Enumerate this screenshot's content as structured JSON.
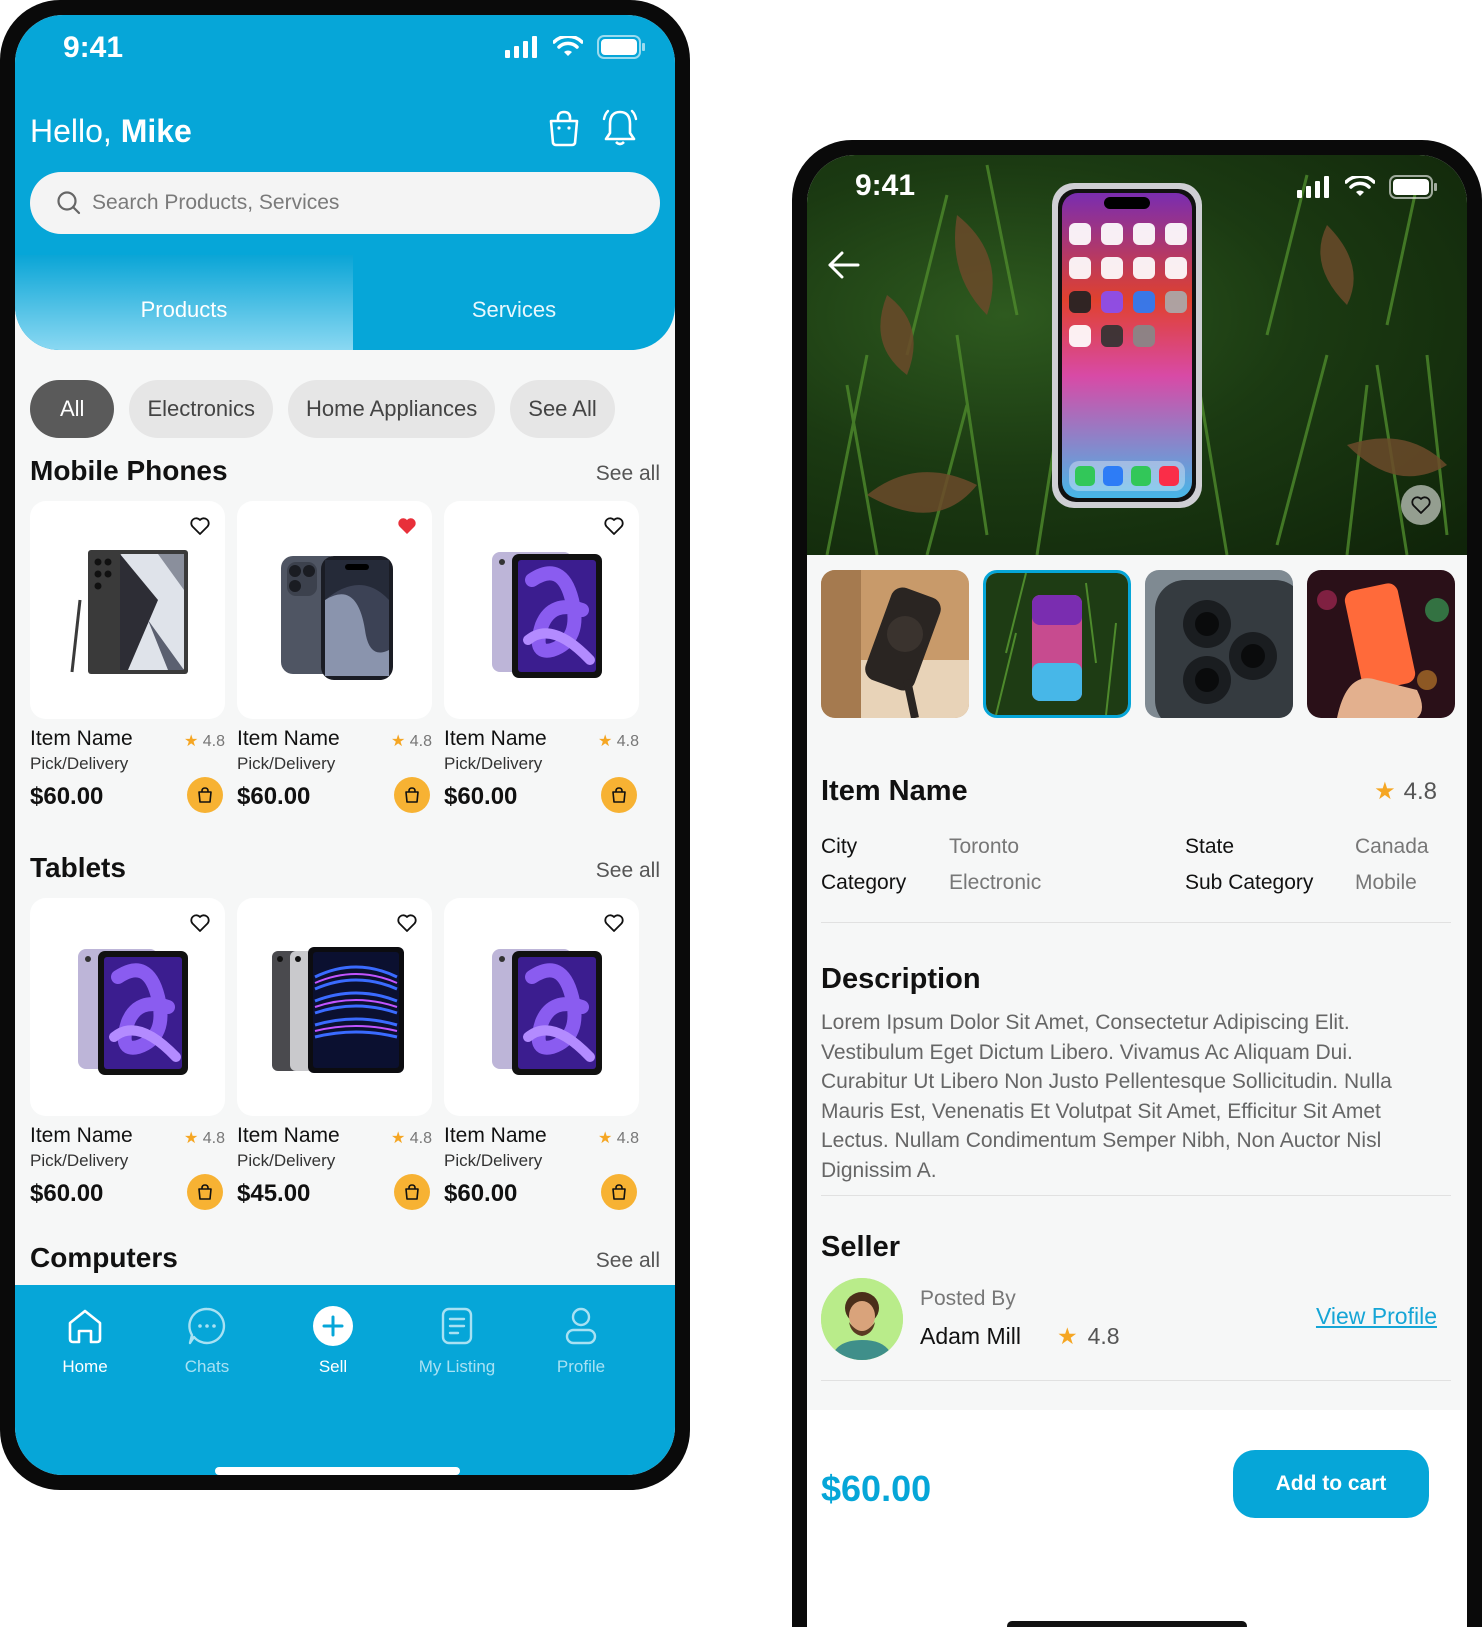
{
  "left_screen": {
    "status_time": "9:41",
    "greeting_prefix": "Hello, ",
    "greeting_name": "Mike",
    "search_placeholder": "Search Products, Services",
    "tabs": [
      "Products",
      "Services"
    ],
    "chips": [
      "All",
      "Electronics",
      "Home Appliances",
      "See All"
    ],
    "sections": [
      {
        "title": "Mobile Phones",
        "see_all": "See all",
        "items": [
          {
            "name": "Item Name",
            "rating": "4.8",
            "delivery": "Pick/Delivery",
            "price": "$60.00",
            "favorite": false,
            "image": "android-phone"
          },
          {
            "name": "Item Name",
            "rating": "4.8",
            "delivery": "Pick/Delivery",
            "price": "$60.00",
            "favorite": true,
            "image": "iphone"
          },
          {
            "name": "Item Name",
            "rating": "4.8",
            "delivery": "Pick/Delivery",
            "price": "$60.00",
            "favorite": false,
            "image": "ipad"
          }
        ]
      },
      {
        "title": "Tablets",
        "see_all": "See all",
        "items": [
          {
            "name": "Item Name",
            "rating": "4.8",
            "delivery": "Pick/Delivery",
            "price": "$60.00",
            "favorite": false,
            "image": "ipad"
          },
          {
            "name": "Item Name",
            "rating": "4.8",
            "delivery": "Pick/Delivery",
            "price": "$45.00",
            "favorite": false,
            "image": "ipad-pro"
          },
          {
            "name": "Item Name",
            "rating": "4.8",
            "delivery": "Pick/Delivery",
            "price": "$60.00",
            "favorite": false,
            "image": "ipad"
          }
        ]
      },
      {
        "title": "Computers",
        "see_all": "See all",
        "items": []
      }
    ],
    "bottom_nav": [
      {
        "label": "Home",
        "icon": "home-icon",
        "active": true
      },
      {
        "label": "Chats",
        "icon": "chat-icon",
        "active": false
      },
      {
        "label": "Sell",
        "icon": "plus-icon",
        "active": true
      },
      {
        "label": "My Listing",
        "icon": "listing-icon",
        "active": false
      },
      {
        "label": "Profile",
        "icon": "profile-icon",
        "active": false
      }
    ]
  },
  "right_screen": {
    "status_time": "9:41",
    "item_name": "Item Name",
    "rating": "4.8",
    "specs": {
      "city_label": "City",
      "city_value": "Toronto",
      "state_label": "State",
      "state_value": "Canada",
      "category_label": "Category",
      "category_value": "Electronic",
      "subcategory_label": "Sub Category",
      "subcategory_value": "Mobile"
    },
    "description_title": "Description",
    "description_text": "Lorem Ipsum Dolor Sit Amet, Consectetur Adipiscing Elit. Vestibulum Eget Dictum Libero. Vivamus Ac Aliquam Dui. Curabitur Ut Libero Non Justo Pellentesque Sollicitudin. Nulla Mauris Est, Venenatis Et Volutpat Sit Amet, Efficitur Sit Amet Lectus. Nullam Condimentum Semper Nibh, Non Auctor Nisl Dignissim A.",
    "seller_title": "Seller",
    "posted_by_label": "Posted By",
    "seller_name": "Adam Mill",
    "seller_rating": "4.8",
    "view_profile": "View Profile",
    "price": "$60.00",
    "add_to_cart": "Add to cart",
    "selected_thumbnail": 2
  },
  "colors": {
    "brand": "#06a6d8",
    "bag_button": "#f7b233",
    "star": "#f5a623",
    "favorite": "#e8303a"
  }
}
